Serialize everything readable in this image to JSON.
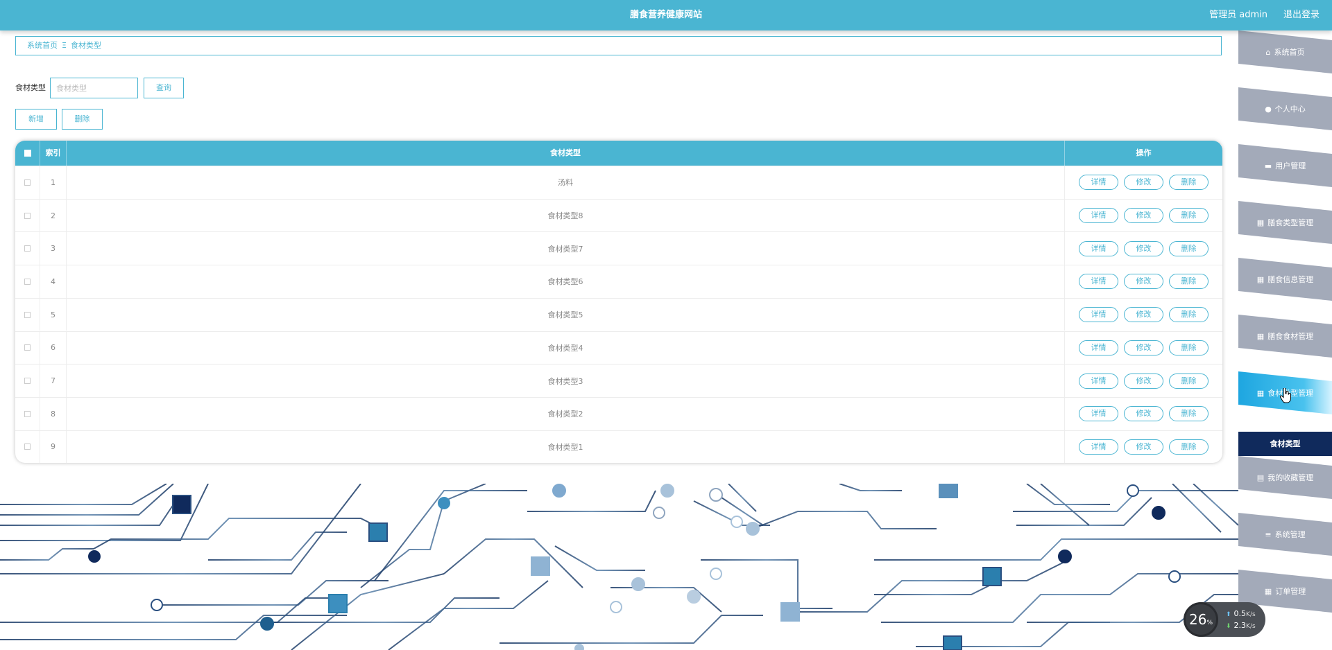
{
  "header": {
    "title": "膳食营养健康网站",
    "user": "管理员 admin",
    "logout": "退出登录"
  },
  "breadcrumb": {
    "home": "系统首页",
    "separator": "Ξ",
    "current": "食材类型"
  },
  "search": {
    "label": "食材类型",
    "placeholder": "食材类型",
    "button": "查询"
  },
  "actions": {
    "add": "新增",
    "delete": "删除"
  },
  "table": {
    "headers": {
      "index": "索引",
      "name": "食材类型",
      "ops": "操作"
    },
    "rows": [
      {
        "index": "1",
        "name": "汤料"
      },
      {
        "index": "2",
        "name": "食材类型8"
      },
      {
        "index": "3",
        "name": "食材类型7"
      },
      {
        "index": "4",
        "name": "食材类型6"
      },
      {
        "index": "5",
        "name": "食材类型5"
      },
      {
        "index": "6",
        "name": "食材类型4"
      },
      {
        "index": "7",
        "name": "食材类型3"
      },
      {
        "index": "8",
        "name": "食材类型2"
      },
      {
        "index": "9",
        "name": "食材类型1"
      }
    ],
    "op_labels": {
      "detail": "详情",
      "edit": "修改",
      "delete": "删除"
    }
  },
  "sidebar": {
    "items": [
      {
        "label": "系统首页",
        "icon": "home-icon",
        "glyph": "⌂"
      },
      {
        "label": "个人中心",
        "icon": "user-icon",
        "glyph": "●"
      },
      {
        "label": "用户管理",
        "icon": "briefcase-icon",
        "glyph": "▬"
      },
      {
        "label": "膳食类型管理",
        "icon": "grid-icon",
        "glyph": "▦"
      },
      {
        "label": "膳食信息管理",
        "icon": "grid-icon",
        "glyph": "▦"
      },
      {
        "label": "膳食食材管理",
        "icon": "grid-icon",
        "glyph": "▦"
      },
      {
        "label": "食材类型管理",
        "icon": "grid-icon",
        "glyph": "▦",
        "active": true
      },
      {
        "label": "我的收藏管理",
        "icon": "clipboard-icon",
        "glyph": "▤"
      },
      {
        "label": "系统管理",
        "icon": "menu-icon",
        "glyph": "≡"
      },
      {
        "label": "订单管理",
        "icon": "table-icon",
        "glyph": "▦"
      }
    ],
    "sub_item": "食材类型"
  },
  "colors": {
    "primary": "#4ab5d2",
    "nav_inactive": "#a3aab9",
    "nav_active": "#1fa8e0",
    "sub_active": "#102a5c"
  },
  "net_widget": {
    "percent": "26",
    "percent_unit": "%",
    "up": "0.5",
    "down": "2.3",
    "unit": "K/s"
  }
}
